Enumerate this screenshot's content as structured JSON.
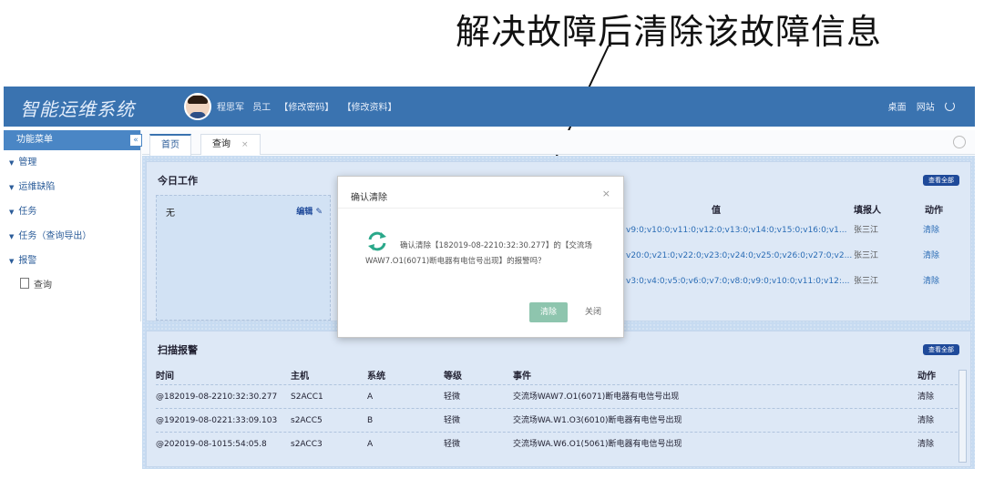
{
  "annotation": {
    "text": "解决故障后清除该故障信息"
  },
  "header": {
    "logo": "智能运维系统",
    "user_name": "程思军",
    "user_role": "员工",
    "link_change_password": "【修改密码】",
    "link_edit_profile": "【修改资料】",
    "right_links": [
      "桌面",
      "网站"
    ]
  },
  "sidebar": {
    "title": "功能菜单",
    "items": [
      "管理",
      "运维缺陷",
      "任务",
      "任务（查询导出）",
      "报警"
    ],
    "sub_item": "查询"
  },
  "tabs": [
    {
      "label": "首页"
    },
    {
      "label": "查询"
    }
  ],
  "today_work": {
    "title": "今日工作",
    "pill": "查看全部",
    "empty_text": "无",
    "edit_label": "编辑",
    "columns": [
      "值",
      "填报人",
      "动作"
    ],
    "rows": [
      {
        "value": "v9:0;v10:0;v11:0;v12:0;v13:0;v14:0;v15:0;v16:0;v1...",
        "reporter": "张三江",
        "action": "清除"
      },
      {
        "value": "v20:0;v21:0;v22:0;v23:0;v24:0;v25:0;v26:0;v27:0;v2...",
        "reporter": "张三江",
        "action": "清除"
      },
      {
        "value": "v3:0;v4:0;v5:0;v6:0;v7:0;v8:0;v9:0;v10:0;v11:0;v12:...",
        "reporter": "张三江",
        "action": "清除"
      }
    ]
  },
  "alarms": {
    "title": "扫描报警",
    "pill": "查看全部",
    "columns": [
      "时间",
      "主机",
      "系统",
      "等级",
      "事件",
      "动作"
    ],
    "rows": [
      {
        "time": "@182019-08-2210:32:30.277",
        "host": "S2ACC1",
        "system": "A",
        "level": "轻微",
        "event": "交流场WAW7.O1(6071)断电器有电信号出现",
        "action": "清除"
      },
      {
        "time": "@192019-08-0221:33:09.103",
        "host": "s2ACC5",
        "system": "B",
        "level": "轻微",
        "event": "交流场WA.W1.O3(6010)断电器有电信号出现",
        "action": "清除"
      },
      {
        "time": "@202019-08-1015:54:05.8",
        "host": "s2ACC3",
        "system": "A",
        "level": "轻微",
        "event": "交流场WA.W6.O1(5061)断电器有电信号出现",
        "action": "清除"
      }
    ]
  },
  "dialog": {
    "title": "确认清除",
    "close_glyph": "×",
    "message": "确认清除【182019-08-2210:32:30.277】的【交流场WAW7.O1(6071)断电器有电信号出现】的报警吗？",
    "confirm_label": "清除",
    "cancel_label": "关闭"
  },
  "icons": {
    "refresh": "refresh-icon",
    "edit": "pencil-icon",
    "power": "power-icon",
    "settings": "settings-icon"
  },
  "colors": {
    "topbar": "#3a73b0",
    "accent": "#2a6cb5",
    "pill": "#1f4a9a",
    "confirm_button": "#8ec5ae",
    "refresh_icon": "#2aa88a"
  }
}
